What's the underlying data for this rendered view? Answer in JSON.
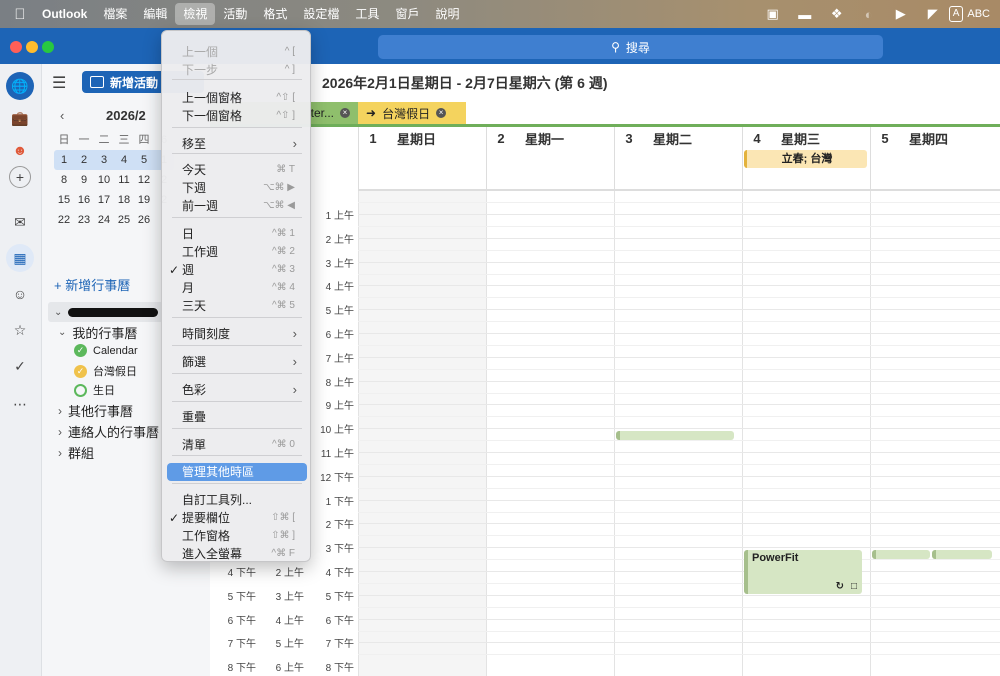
{
  "menubar": {
    "app": "Outlook",
    "items": [
      "檔案",
      "編輯",
      "檢視",
      "活動",
      "格式",
      "設定檔",
      "工具",
      "窗戶",
      "說明"
    ],
    "input_method": "A",
    "input_label": "ABC"
  },
  "search": {
    "label": "搜尋"
  },
  "sidebar": {
    "new_event": "新增活動",
    "mini_calendar": {
      "month": "2026/2",
      "weekday_headers": [
        "日",
        "一",
        "二",
        "三",
        "四"
      ],
      "weeks": [
        [
          "1",
          "2",
          "3",
          "4",
          "5"
        ],
        [
          "8",
          "9",
          "10",
          "11",
          "12"
        ],
        [
          "15",
          "16",
          "17",
          "18",
          "19"
        ],
        [
          "22",
          "23",
          "24",
          "25",
          "26"
        ]
      ],
      "partial_col": [
        "6",
        "1",
        "2",
        "2"
      ]
    },
    "add_calendar": "+ 新增行事曆",
    "my_calendars": "我的行事曆",
    "calendars": [
      "Calendar",
      "台灣假日",
      "生日"
    ],
    "other_calendars": "其他行事曆",
    "contact_calendars": "連絡人的行事曆",
    "groups": "群組"
  },
  "header": {
    "week_title": "2026年2月1日星期日 - 2月7日星期六 (第 6 週)"
  },
  "tabs": [
    {
      "label": "ter...",
      "color": "#8fbf6c"
    },
    {
      "label": "台灣假日",
      "color": "#f4d35e"
    }
  ],
  "days": [
    {
      "num": "1",
      "name": "星期日"
    },
    {
      "num": "2",
      "name": "星期一"
    },
    {
      "num": "3",
      "name": "星期二"
    },
    {
      "num": "4",
      "name": "星期三"
    },
    {
      "num": "5",
      "name": "星期四"
    }
  ],
  "time_labels": {
    "col3": [
      "1 上午",
      "2 上午",
      "3 上午",
      "4 上午",
      "5 上午",
      "6 上午",
      "7 上午",
      "8 上午",
      "9 上午",
      "10 上午",
      "11 上午",
      "12 下午",
      "1 下午",
      "2 下午",
      "3 下午",
      "4 下午",
      "5 下午",
      "6 下午",
      "7 下午",
      "8 下午"
    ],
    "col1": [
      "4 下午",
      "5 下午",
      "6 下午",
      "7 下午",
      "8 下午"
    ],
    "col2": [
      "2 上午",
      "3 上午",
      "4 上午",
      "5 上午",
      "6 上午"
    ]
  },
  "events": {
    "holiday": "立春; 台灣",
    "powerfit": "PowerFit"
  },
  "view_menu": {
    "items": [
      {
        "label": "上一個",
        "shortcut": "^ [",
        "disabled": true
      },
      {
        "label": "下一步",
        "shortcut": "^ ]",
        "disabled": true
      },
      {
        "label": "上一個窗格",
        "shortcut": "^⇧ ["
      },
      {
        "label": "下一個窗格",
        "shortcut": "^⇧ ]"
      },
      {
        "label": "移至",
        "submenu": true
      },
      {
        "label": "今天",
        "shortcut": "⌘ T"
      },
      {
        "label": "下週",
        "shortcut": "⌥⌘ ▶"
      },
      {
        "label": "前一週",
        "shortcut": "⌥⌘ ◀"
      },
      {
        "label": "日",
        "shortcut": "^⌘ 1"
      },
      {
        "label": "工作週",
        "shortcut": "^⌘ 2"
      },
      {
        "label": "週",
        "shortcut": "^⌘ 3",
        "checked": true
      },
      {
        "label": "月",
        "shortcut": "^⌘ 4"
      },
      {
        "label": "三天",
        "shortcut": "^⌘ 5"
      },
      {
        "label": "時間刻度",
        "submenu": true
      },
      {
        "label": "篩選",
        "submenu": true
      },
      {
        "label": "色彩",
        "submenu": true
      },
      {
        "label": "重疊"
      },
      {
        "label": "清單",
        "shortcut": "^⌘ 0"
      },
      {
        "label": "管理其他時區",
        "highlighted": true
      },
      {
        "label": "自訂工具列..."
      },
      {
        "label": "提要欄位",
        "shortcut": "⇧⌘ [",
        "checked": true
      },
      {
        "label": "工作窗格",
        "shortcut": "⇧⌘ ]"
      },
      {
        "label": "進入全螢幕",
        "shortcut": "^⌘ F"
      }
    ]
  },
  "colors": {
    "brand": "#1d64b6",
    "highlight": "#5f9be6",
    "event_green": "#d6e6c4",
    "holiday_yellow": "#fbe6b4"
  }
}
